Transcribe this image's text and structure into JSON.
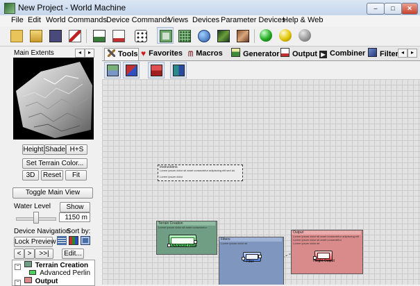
{
  "window": {
    "title": "New Project - World Machine",
    "controls": [
      "–",
      "□",
      "✕"
    ]
  },
  "menu": [
    "File",
    "Edit",
    "World Commands",
    "Device Commands",
    "Views",
    "Devices",
    "Parameter Devices",
    "Help & Web"
  ],
  "toolbar": {
    "buttons": [
      {
        "name": "new-project",
        "icon": "new-folder-icon"
      },
      {
        "name": "open-project",
        "icon": "open-folder-icon"
      },
      {
        "name": "save-project",
        "icon": "save-disk-icon"
      },
      {
        "name": "macro-tool",
        "icon": "magic-wand-icon"
      },
      {
        "name": "build-view",
        "icon": "terrain-chart-icon"
      },
      {
        "name": "output-doc",
        "icon": "document-icon"
      },
      {
        "name": "randomize",
        "icon": "dice-icon"
      },
      {
        "name": "device-workview",
        "icon": "workview-icon",
        "pressed": true
      },
      {
        "name": "layout-view",
        "icon": "grid-layout-icon"
      },
      {
        "name": "world-view",
        "icon": "globe-icon"
      },
      {
        "name": "3d-preview",
        "icon": "mountain-icon"
      },
      {
        "name": "texture-view",
        "icon": "texture-icon"
      },
      {
        "name": "build-normal",
        "icon": "green-sphere-icon",
        "color": "#22aa22"
      },
      {
        "name": "build-extents",
        "icon": "yellow-sphere-icon",
        "color": "#e0c400"
      },
      {
        "name": "build-full",
        "icon": "gray-sphere-icon",
        "color": "#9a9a9a"
      }
    ]
  },
  "left_panel": {
    "title": "Main Extents",
    "view_buttons": [
      "Height",
      "Shade",
      "H+S"
    ],
    "set_terrain_color": "Set Terrain Color...",
    "nav_buttons": [
      "3D",
      "Reset",
      "Fit"
    ],
    "toggle_main_view": "Toggle Main View",
    "water_level_label": "Water Level",
    "show_button": "Show",
    "water_level_value": "1150 m",
    "device_navigation_label": "Device Navigation",
    "sort_by_label": "Sort by:",
    "lock_preview": "Lock Preview",
    "nav_arrows": [
      "<",
      ">",
      ">>|"
    ],
    "edit_button": "Edit...",
    "tree": [
      {
        "label": "Terrain Creation",
        "bold": true
      },
      {
        "label": "Advanced Perlin",
        "bold": false
      },
      {
        "label": "Output",
        "bold": true
      }
    ]
  },
  "tabs": [
    {
      "label": "Tools",
      "icon": "tools-icon",
      "active": true
    },
    {
      "label": "Favorites",
      "icon": "heart-icon"
    },
    {
      "label": "Macros",
      "icon": "macro-icon"
    },
    {
      "label": "Generator",
      "icon": "generator-icon"
    },
    {
      "label": "Output",
      "icon": "output-icon"
    },
    {
      "label": "Combiner",
      "icon": "combiner-icon"
    },
    {
      "label": "Filter",
      "icon": "filter-icon"
    }
  ],
  "canvas": {
    "comment_box": {
      "title": "Instructions",
      "lines": [
        "Lorem ipsum dolor sit amet consectetur adipiscing elit sed do",
        "Lorem ipsum dolor"
      ]
    },
    "groups": [
      {
        "title": "Terrain Creation",
        "color": "#6f9e84",
        "lines": [
          "Lorem ipsum dolor sit amet consectetur"
        ]
      },
      {
        "title": "Filters",
        "color": "#7f97bf",
        "lines": [
          "Lorem ipsum dolor sit"
        ]
      },
      {
        "title": "Output",
        "color": "#d98a8a",
        "lines": [
          "Lorem ipsum dolor sit amet consectetur adipiscing elit",
          "Lorem ipsum dolor sit amet consectetur",
          "Lorem ipsum dolor sit"
        ]
      }
    ],
    "nodes": [
      {
        "label": "Advanced Perlin",
        "color": "#4cd35f"
      },
      {
        "label": "Filter",
        "color": "#4f7ce0"
      },
      {
        "label": "Height Output",
        "color": "#e2474b"
      }
    ]
  }
}
